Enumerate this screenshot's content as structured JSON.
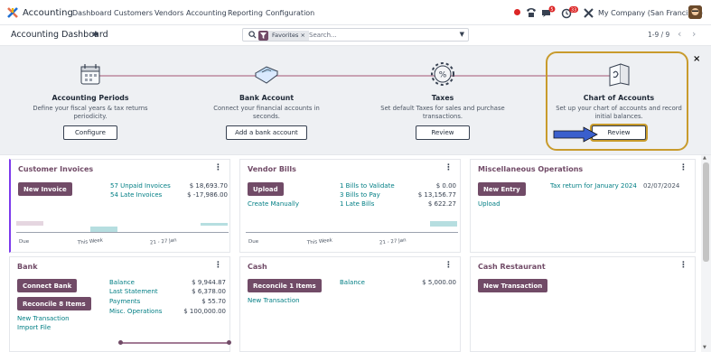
{
  "nav": {
    "app_name": "Accounting",
    "menu": [
      "Dashboard",
      "Customers",
      "Vendors",
      "Accounting",
      "Reporting",
      "Configuration"
    ],
    "badges": {
      "chat": "5",
      "activity": "33"
    },
    "company": "My Company (San Francisco)"
  },
  "control_panel": {
    "title": "Accounting Dashboard",
    "filter_label": "Favorites",
    "search_placeholder": "Search...",
    "pager": "1-9 / 9"
  },
  "onboarding": {
    "steps": [
      {
        "title": "Accounting Periods",
        "desc": "Define your fiscal years & tax returns periodicity.",
        "button": "Configure"
      },
      {
        "title": "Bank Account",
        "desc": "Connect your financial accounts in seconds.",
        "button": "Add a bank account"
      },
      {
        "title": "Taxes",
        "desc": "Set default Taxes for sales and purchase transactions.",
        "button": "Review"
      },
      {
        "title": "Chart of Accounts",
        "desc": "Set up your chart of accounts and record initial balances.",
        "button": "Review"
      }
    ],
    "close": "×",
    "highlight_color": "#c89b2c",
    "arrow_color": "#3a5fcd"
  },
  "cards": {
    "customer_invoices": {
      "title": "Customer Invoices",
      "button": "New Invoice",
      "stats": [
        {
          "label": "57 Unpaid Invoices",
          "amount": "$ 18,693.70"
        },
        {
          "label": "54 Late Invoices",
          "amount": "$ -17,986.00"
        }
      ],
      "axis": [
        "Due",
        "This Week",
        "21 - 27 Jan"
      ]
    },
    "vendor_bills": {
      "title": "Vendor Bills",
      "button": "Upload",
      "create_link": "Create Manually",
      "stats": [
        {
          "label": "1 Bills to Validate",
          "amount": "$ 0.00"
        },
        {
          "label": "3 Bills to Pay",
          "amount": "$ 13,156.77"
        },
        {
          "label": "1 Late Bills",
          "amount": "$ 622.27"
        }
      ],
      "axis": [
        "Due",
        "This Week",
        "21 - 27 Jan"
      ]
    },
    "misc_ops": {
      "title": "Miscellaneous Operations",
      "button": "New Entry",
      "upload_link": "Upload",
      "tax_return": "Tax return for January 2024",
      "tax_date": "02/07/2024"
    },
    "bank": {
      "title": "Bank",
      "buttons": [
        "Connect Bank",
        "Reconcile 8 Items"
      ],
      "links": [
        "New Transaction",
        "Import File"
      ],
      "stats": [
        {
          "label": "Balance",
          "amount": "$ 9,944.87"
        },
        {
          "label": "Last Statement",
          "amount": "$ 6,378.00"
        },
        {
          "label": "Payments",
          "amount": "$ 55.70"
        },
        {
          "label": "Misc. Operations",
          "amount": "$ 100,000.00"
        }
      ]
    },
    "cash": {
      "title": "Cash",
      "button": "Reconcile 1 Items",
      "link": "New Transaction",
      "stat_label": "Balance",
      "stat_amount": "$ 5,000.00"
    },
    "cash_restaurant": {
      "title": "Cash Restaurant",
      "button": "New Transaction"
    }
  },
  "colors": {
    "primary": "#714b67",
    "link": "#017e84"
  }
}
